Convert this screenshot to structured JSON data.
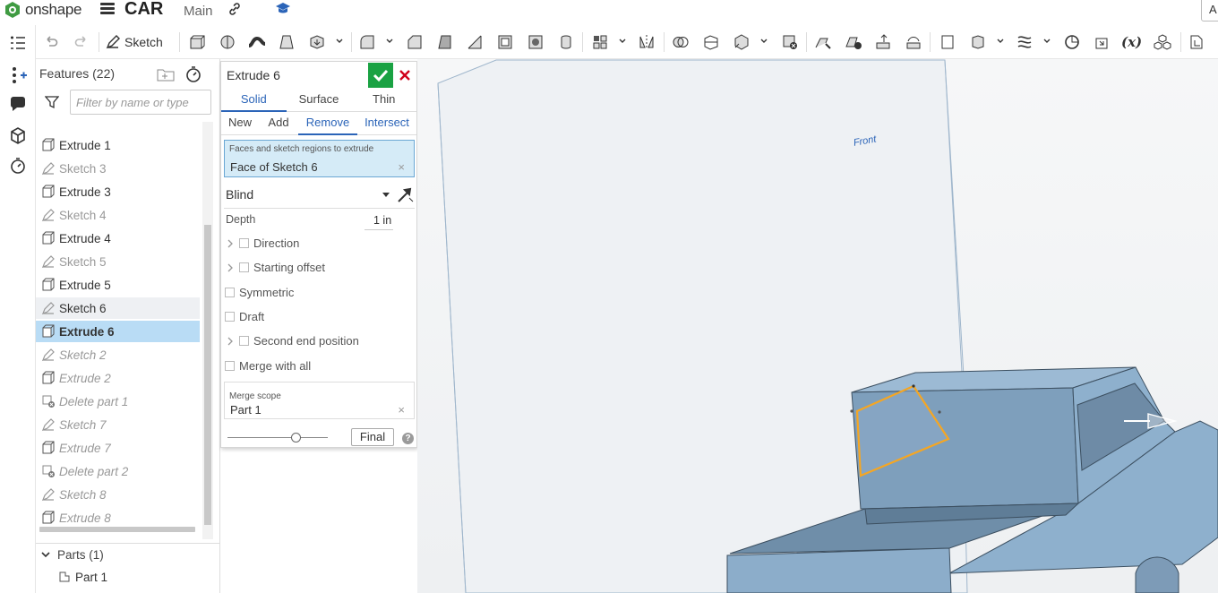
{
  "app": {
    "brand": "onshape",
    "document_title": "CAR",
    "workspace": "Main",
    "account_initial": "A"
  },
  "toolbar": {
    "sketch_label": "Sketch"
  },
  "features": {
    "header": "Features (22)",
    "filter_placeholder": "Filter by name or type",
    "items": [
      {
        "label": "Extrude 1",
        "icon": "extrude-icon",
        "state": "normal"
      },
      {
        "label": "Sketch 3",
        "icon": "sketch-icon",
        "state": "dim"
      },
      {
        "label": "Extrude 3",
        "icon": "extrude-icon",
        "state": "normal"
      },
      {
        "label": "Sketch 4",
        "icon": "sketch-icon",
        "state": "dim"
      },
      {
        "label": "Extrude 4",
        "icon": "extrude-icon",
        "state": "normal"
      },
      {
        "label": "Sketch 5",
        "icon": "sketch-icon",
        "state": "dim"
      },
      {
        "label": "Extrude 5",
        "icon": "extrude-icon",
        "state": "normal"
      },
      {
        "label": "Sketch 6",
        "icon": "sketch-icon",
        "state": "hover"
      },
      {
        "label": "Extrude 6",
        "icon": "extrude-icon",
        "state": "selected"
      },
      {
        "label": "Sketch 2",
        "icon": "sketch-icon",
        "state": "rolled"
      },
      {
        "label": "Extrude 2",
        "icon": "extrude-icon",
        "state": "rolled"
      },
      {
        "label": "Delete part 1",
        "icon": "delete-part-icon",
        "state": "rolled"
      },
      {
        "label": "Sketch 7",
        "icon": "sketch-icon",
        "state": "rolled"
      },
      {
        "label": "Extrude 7",
        "icon": "extrude-icon",
        "state": "rolled"
      },
      {
        "label": "Delete part 2",
        "icon": "delete-part-icon",
        "state": "rolled"
      },
      {
        "label": "Sketch 8",
        "icon": "sketch-icon",
        "state": "rolled"
      },
      {
        "label": "Extrude 8",
        "icon": "extrude-icon",
        "state": "rolled"
      }
    ],
    "parts_header": "Parts (1)",
    "parts": [
      {
        "label": "Part 1"
      }
    ]
  },
  "dialog": {
    "title": "Extrude 6",
    "type_tabs": [
      "Solid",
      "Surface",
      "Thin"
    ],
    "active_type": "Solid",
    "op_tabs": [
      "New",
      "Add",
      "Remove",
      "Intersect"
    ],
    "active_op": "Remove",
    "faces_caption": "Faces and sketch regions to extrude",
    "faces_value": "Face of Sketch 6",
    "end_type": "Blind",
    "depth_label": "Depth",
    "depth_value": "1 in",
    "options": {
      "direction": "Direction",
      "starting_offset": "Starting offset",
      "symmetric": "Symmetric",
      "draft": "Draft",
      "second_end": "Second end position",
      "merge_all": "Merge with all"
    },
    "merge_scope_caption": "Merge scope",
    "merge_scope_value": "Part 1",
    "final_label": "Final",
    "help_label": "?",
    "clear_glyph": "×",
    "rollback_fraction": 0.68
  },
  "viewport": {
    "plane_label": "Front",
    "colors": {
      "background": "#f2f4f6",
      "part": "#8fb3d0",
      "part_dark": "#7a9fbd",
      "selection": "#f5a623",
      "accent": "#2b64b8",
      "ok": "#1aa243",
      "cancel": "#d0021b"
    }
  }
}
